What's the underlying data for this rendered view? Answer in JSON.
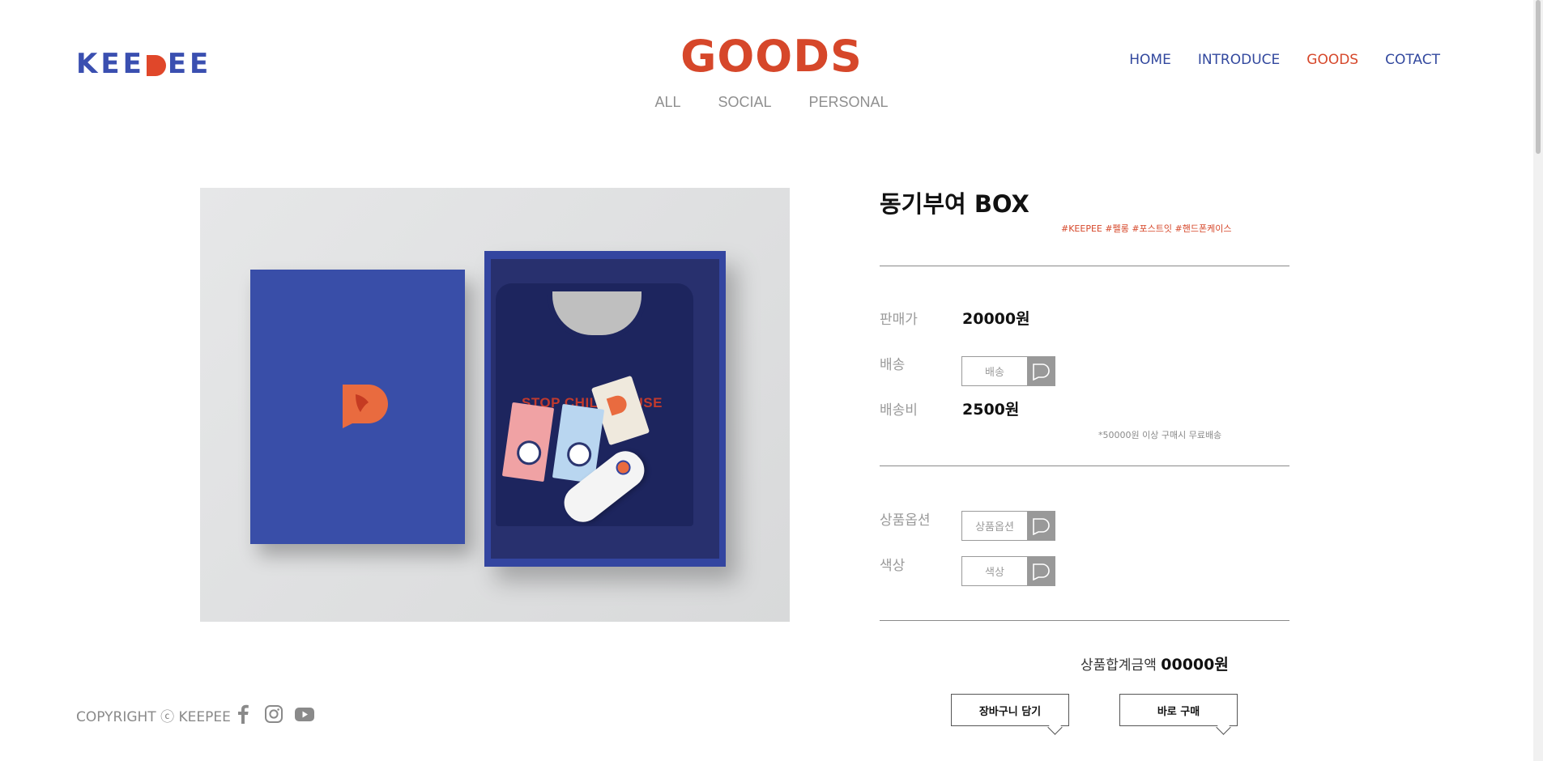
{
  "header": {
    "logo_text": "KEEPEE",
    "page_title": "GOODS",
    "subnav": [
      "ALL",
      "SOCIAL",
      "PERSONAL"
    ],
    "nav": [
      "HOME",
      "INTRODUCE",
      "GOODS",
      "COTACT"
    ],
    "active_nav": "GOODS"
  },
  "product": {
    "image_slogan": "STOP CHILD ABUSE",
    "title": "동기부여 BOX",
    "hashtags": "#KEEPEE #펠롱 #포스트잇 #핸드폰케이스",
    "price_label": "판매가",
    "price_value": "20000원",
    "shipping_label": "배송",
    "shipping_select": "배송",
    "shipping_fee_label": "배송비",
    "shipping_fee_value": "2500원",
    "free_shipping_note": "*50000원 이상 구매시 무료배송",
    "option_label": "상품옵션",
    "option_select": "상품옵션",
    "color_label": "색상",
    "color_select": "색상",
    "total_label": "상품합계금액",
    "total_value": "00000원",
    "cart_button": "장바구니 담기",
    "buy_button": "바로 구매"
  },
  "footer": {
    "copyright": "COPYRIGHT ⓒ KEEPEE",
    "social_icons": [
      "facebook-icon",
      "instagram-icon",
      "youtube-icon"
    ]
  },
  "colors": {
    "brand_blue": "#3a4fb0",
    "accent_red": "#d6472a",
    "nav_blue": "#32489e",
    "muted_gray": "#9a9a9a"
  }
}
